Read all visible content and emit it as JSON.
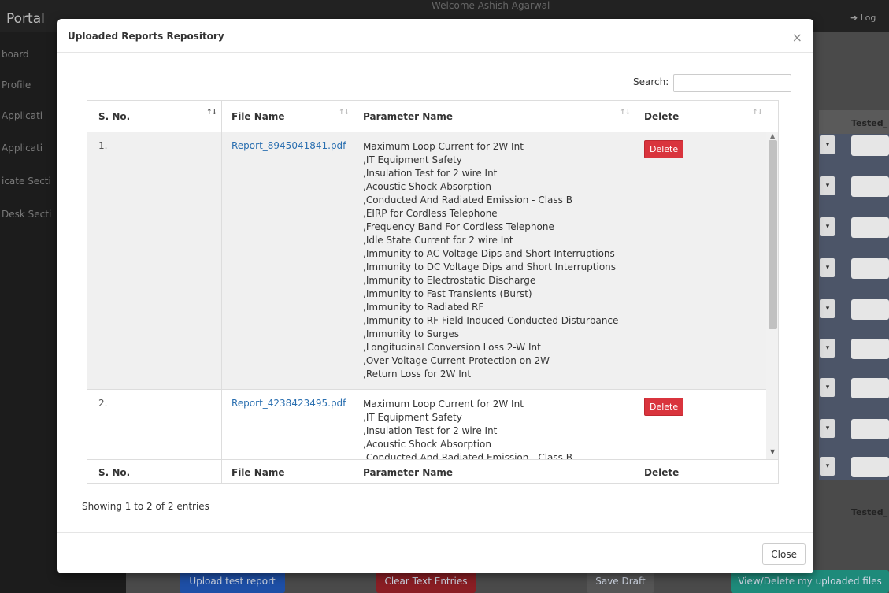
{
  "background": {
    "brand": "Portal",
    "welcome": "Welcome Ashish Agarwal",
    "logout": "➜ Log",
    "sidebar": [
      "board",
      "Profile",
      "Applicati",
      "Applicati",
      "icate Secti",
      "Desk Secti"
    ],
    "tested_header": "Tested_",
    "buttons": {
      "upload": "Upload test report",
      "clear": "Clear Text Entries",
      "save": "Save Draft",
      "view": "View/Delete my uploaded files"
    }
  },
  "modal": {
    "title": "Uploaded Reports Repository",
    "close_symbol": "×",
    "search_label": "Search:",
    "search_value": "",
    "columns": [
      "S. No.",
      "File Name",
      "Parameter Name",
      "Delete"
    ],
    "rows": [
      {
        "no": "1.",
        "file": "Report_8945041841.pdf",
        "params": [
          "Maximum Loop Current for 2W Int",
          ",IT Equipment Safety",
          ",Insulation Test for 2 wire Int",
          ",Acoustic Shock Absorption",
          ",Conducted And Radiated Emission - Class B",
          ",EIRP for Cordless Telephone",
          ",Frequency Band For Cordless Telephone",
          ",Idle State Current for 2 wire Int",
          ",Immunity to AC Voltage Dips and Short Interruptions",
          ",Immunity to DC Voltage Dips and Short Interruptions",
          ",Immunity to Electrostatic Discharge",
          ",Immunity to Fast Transients (Burst)",
          ",Immunity to Radiated RF",
          ",Immunity to RF Field Induced Conducted Disturbance",
          ",Immunity to Surges",
          ",Longitudinal Conversion Loss 2-W Int",
          ",Over Voltage Current Protection on 2W",
          ",Return Loss for 2W Int"
        ],
        "delete_label": "Delete"
      },
      {
        "no": "2.",
        "file": "Report_4238423495.pdf",
        "params": [
          "Maximum Loop Current for 2W Int",
          ",IT Equipment Safety",
          ",Insulation Test for 2 wire Int",
          ",Acoustic Shock Absorption",
          ",Conducted And Radiated Emission - Class B"
        ],
        "delete_label": "Delete"
      }
    ],
    "info": "Showing 1 to 2 of 2 entries",
    "close_button": "Close"
  }
}
